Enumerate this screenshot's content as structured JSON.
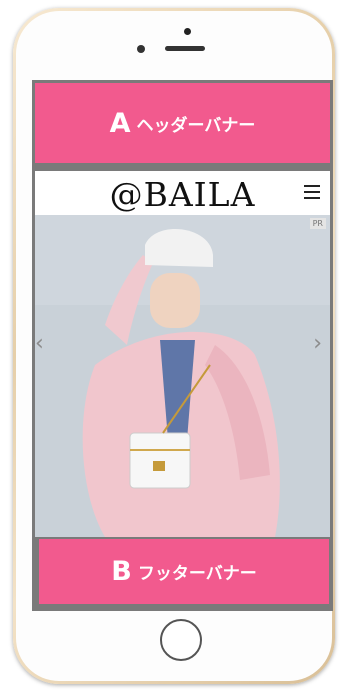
{
  "header_banner": {
    "letter": "A",
    "text": "ヘッダーバナー"
  },
  "site": {
    "logo": "@BAILA",
    "pr_badge": "PR",
    "menu_icon": "hamburger-menu-icon"
  },
  "carousel": {
    "prev_icon": "chevron-left-icon",
    "next_icon": "chevron-right-icon",
    "prev": "‹",
    "next": "›"
  },
  "footer_banner": {
    "letter": "B",
    "text": "フッターバナー"
  },
  "colors": {
    "banner": "#f25a8e",
    "frame": "#e9d3b0"
  }
}
